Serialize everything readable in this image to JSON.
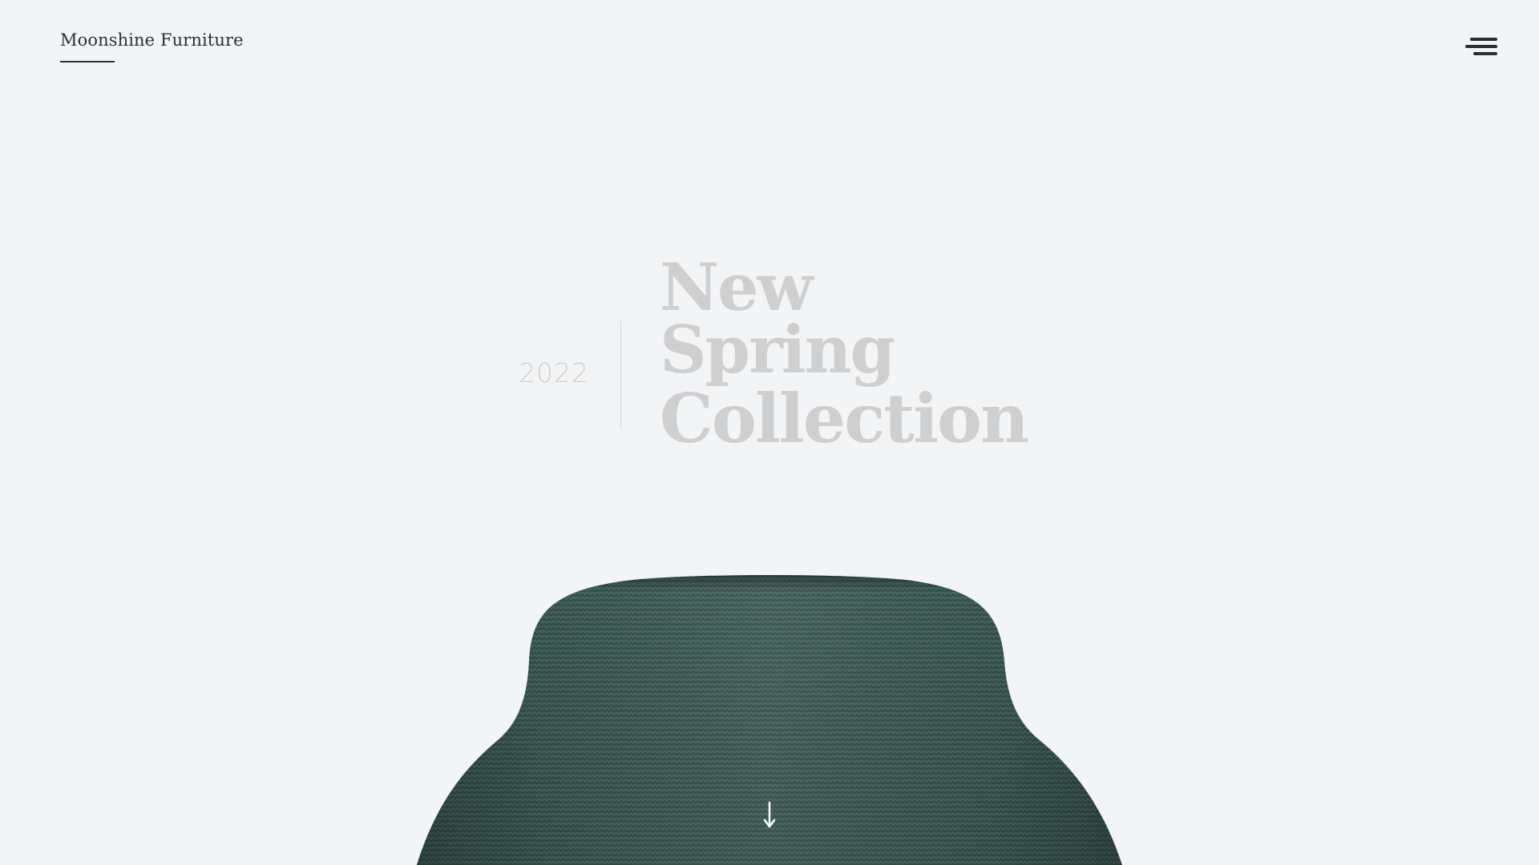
{
  "header": {
    "brand": "Moonshine Furniture",
    "menu_icon": "hamburger-menu-icon"
  },
  "hero": {
    "year": "2022",
    "headline": [
      "New",
      "Spring",
      "Collection"
    ],
    "image": "green knit fabric armchair",
    "scroll_icon": "arrow-down-icon"
  },
  "colors": {
    "background": "#f3f4f6",
    "headline": "#cfcfcf",
    "text": "#2d2f33",
    "chair": "#3e5c58"
  }
}
